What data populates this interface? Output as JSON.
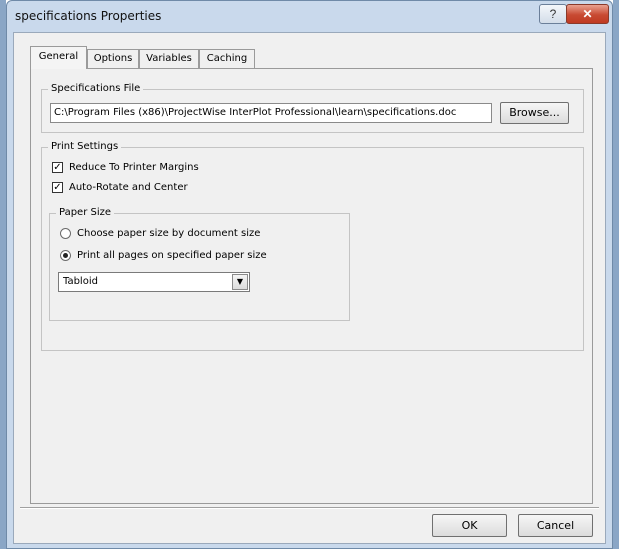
{
  "window": {
    "title": "specifications Properties",
    "help_label": "?",
    "close_label": "✕"
  },
  "tabs": [
    {
      "label": "General",
      "active": true
    },
    {
      "label": "Options",
      "active": false
    },
    {
      "label": "Variables",
      "active": false
    },
    {
      "label": "Caching",
      "active": false
    }
  ],
  "specifications_file": {
    "legend": "Specifications File",
    "path": "C:\\Program Files (x86)\\ProjectWise InterPlot Professional\\learn\\specifications.doc",
    "browse_label": "Browse..."
  },
  "print_settings": {
    "legend": "Print Settings",
    "reduce_margins": {
      "label": "Reduce To Printer Margins",
      "checked": true
    },
    "auto_rotate": {
      "label": "Auto-Rotate and Center",
      "checked": true
    },
    "paper_size": {
      "legend": "Paper Size",
      "by_document": {
        "label": "Choose paper size by document size",
        "selected": false
      },
      "specified": {
        "label": "Print all pages on specified paper size",
        "selected": true
      },
      "selected_size": "Tabloid"
    }
  },
  "footer": {
    "ok_label": "OK",
    "cancel_label": "Cancel"
  },
  "colors": {
    "close_button": "#c84a32",
    "window_frame": "#c9d9ec"
  }
}
